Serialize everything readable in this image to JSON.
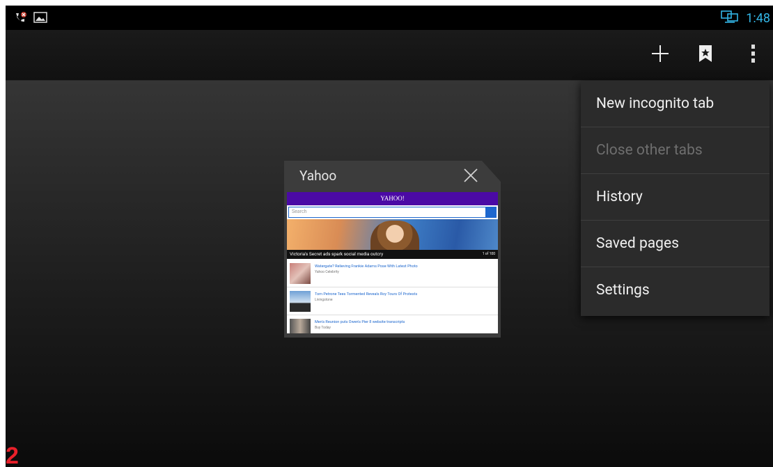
{
  "status_bar": {
    "time": "1:48"
  },
  "tab": {
    "title": "Yahoo",
    "thumbnail": {
      "brand": "YAHOO!",
      "search_placeholder": "Search",
      "headline": "Victoria's Secret ads spark social media outcry",
      "counter": "1 of 100",
      "items": [
        {
          "title": "Watergate? Relieving Frankie Adams Pose With Latest Photo",
          "source": "Yahoo Celebrity"
        },
        {
          "title": "Tom Petrone Tees Tormented Reveals Roy Tours Of Protests",
          "source": "Livingstone"
        },
        {
          "title": "Men's Reunion puts Owen's Pier 8 website transcripts",
          "source": "Buy Today"
        }
      ]
    }
  },
  "menu": {
    "items": [
      {
        "label": "New incognito tab",
        "enabled": true
      },
      {
        "label": "Close other tabs",
        "enabled": false
      },
      {
        "label": "History",
        "enabled": true
      },
      {
        "label": "Saved pages",
        "enabled": true
      },
      {
        "label": "Settings",
        "enabled": true
      }
    ]
  },
  "annotation": {
    "label": "2"
  },
  "colors": {
    "accent": "#33b5e5",
    "yahoo_purple": "#4b0aa5",
    "annotation_red": "#e8202a"
  },
  "icons": [
    "missed-call-icon",
    "image-notification-icon",
    "screen-cast-icon",
    "new-tab-icon",
    "bookmarks-icon",
    "overflow-menu-icon",
    "close-icon"
  ]
}
